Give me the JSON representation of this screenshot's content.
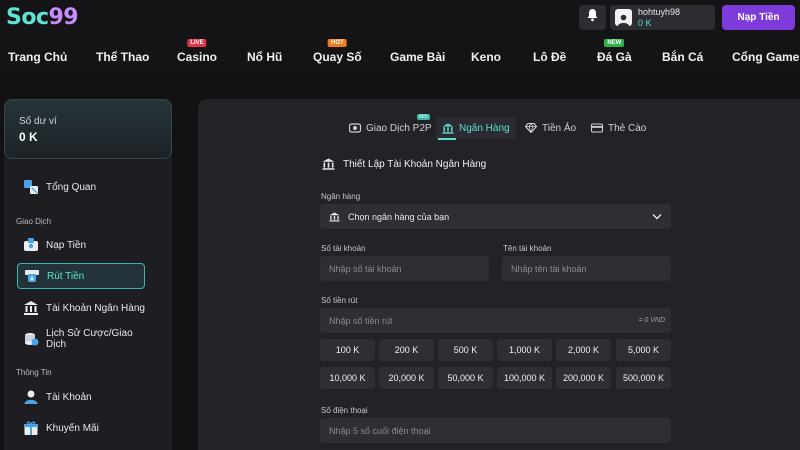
{
  "brand": {
    "logo_part1": "Soc",
    "logo_part2": "99"
  },
  "header": {
    "username": "hohtuyh98",
    "balance": "0 K",
    "deposit_label": "Nạp Tiền"
  },
  "nav": [
    {
      "label": "Trang Chủ",
      "badge": ""
    },
    {
      "label": "Thể Thao",
      "badge": ""
    },
    {
      "label": "Casino",
      "badge": "LIVE",
      "badge_color": "#e0344a"
    },
    {
      "label": "Nổ Hũ",
      "badge": ""
    },
    {
      "label": "Quay Số",
      "badge": "HOT",
      "badge_color": "#f07a1a"
    },
    {
      "label": "Game Bài",
      "badge": ""
    },
    {
      "label": "Keno",
      "badge": ""
    },
    {
      "label": "Lô Đề",
      "badge": ""
    },
    {
      "label": "Đá Gà",
      "badge": "NEW",
      "badge_color": "#2bb34a"
    },
    {
      "label": "Bắn Cá",
      "badge": ""
    },
    {
      "label": "Cổng Game",
      "badge": ""
    }
  ],
  "sidebar": {
    "wallet_label": "Số dư ví",
    "wallet_value": "0 K",
    "overview": "Tổng Quan",
    "section_transactions": "Giao Dịch",
    "items_transactions": [
      {
        "label": "Nạp Tiền",
        "icon": "deposit-icon"
      },
      {
        "label": "Rút Tiền",
        "icon": "withdraw-icon",
        "active": true
      },
      {
        "label": "Tài Khoản Ngân Hàng",
        "icon": "bank-icon"
      },
      {
        "label": "Lịch Sử Cược/Giao Dịch",
        "icon": "history-icon"
      }
    ],
    "section_info": "Thông Tin",
    "items_info": [
      {
        "label": "Tài Khoản",
        "icon": "account-icon"
      },
      {
        "label": "Khuyến Mãi",
        "icon": "gift-icon"
      }
    ]
  },
  "tabs": [
    {
      "label": "Giao Dịch P2P",
      "badge": "Mới",
      "icon": "p2p-icon"
    },
    {
      "label": "Ngân Hàng",
      "icon": "bank-icon",
      "active": true
    },
    {
      "label": "Tiền Ảo",
      "icon": "crypto-icon"
    },
    {
      "label": "Thẻ Cào",
      "icon": "card-icon"
    }
  ],
  "form": {
    "title": "Thiết Lập Tài Khoản Ngân Hàng",
    "bank_label": "Ngân hàng",
    "bank_value": "Chọn ngân hàng của bạn",
    "account_number_label": "Số tài khoản",
    "account_number_placeholder": "Nhập số tài khoản",
    "account_name_label": "Tên tài khoản",
    "account_name_placeholder": "Nhập tên tài khoản",
    "amount_label": "Số tiền rút",
    "amount_placeholder": "Nhập số tiền rút",
    "amount_suffix": "= 0 VND",
    "amounts": [
      "100 K",
      "200 K",
      "500 K",
      "1,000 K",
      "2,000 K",
      "5,000 K",
      "10,000 K",
      "20,000 K",
      "50,000 K",
      "100,000 K",
      "200,000 K",
      "500,000 K"
    ],
    "phone_label": "Số điện thoại",
    "phone_placeholder": "Nhập 5 số cuối điện thoại"
  },
  "colors": {
    "accent": "#59e0d0",
    "primary_button": "#7e3bdc"
  }
}
